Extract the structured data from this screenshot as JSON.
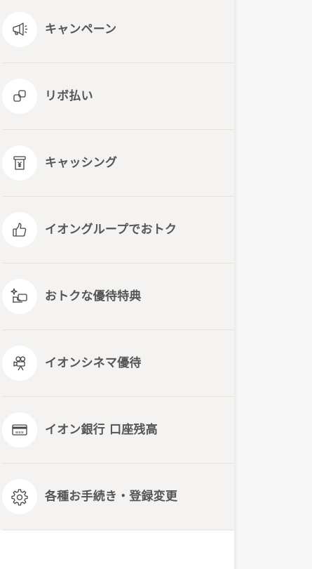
{
  "menu": {
    "items": [
      {
        "label": "キャンペーン",
        "icon": "megaphone-icon"
      },
      {
        "label": "リボ払い",
        "icon": "revolving-squares-icon"
      },
      {
        "label": "キャッシング",
        "icon": "atm-yen-icon"
      },
      {
        "label": "イオングループでおトク",
        "icon": "thumbs-up-icon"
      },
      {
        "label": "おトクな優待特典",
        "icon": "sparkle-card-icon"
      },
      {
        "label": "イオンシネマ優待",
        "icon": "movie-camera-icon"
      },
      {
        "label": "イオン銀行 口座残高",
        "icon": "bank-card-icon"
      },
      {
        "label": "各種お手続き・登録変更",
        "icon": "gear-icon"
      }
    ]
  },
  "colors": {
    "menu_background": "#f4f3f1",
    "label_text": "#555555",
    "icon_stroke": "#444444"
  }
}
